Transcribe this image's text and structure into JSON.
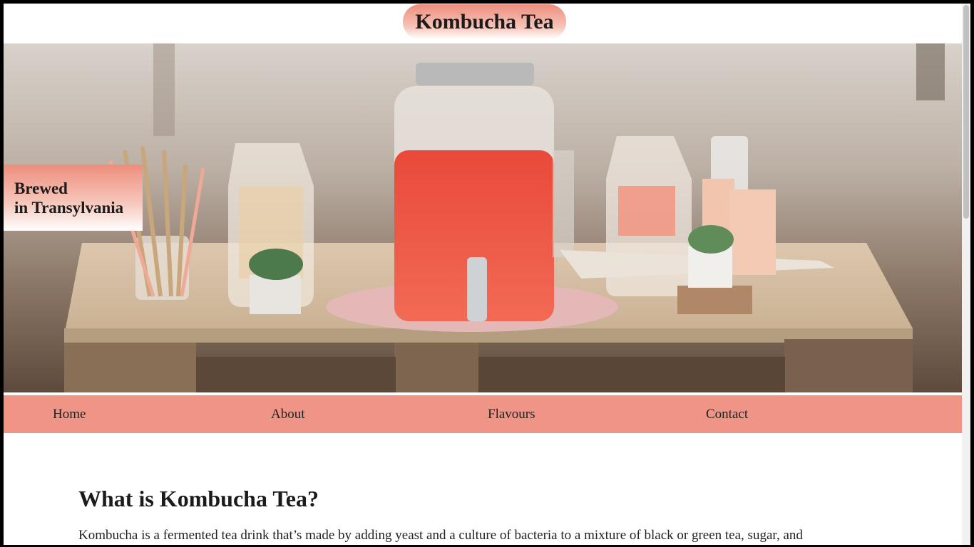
{
  "header": {
    "title": "Kombucha Tea"
  },
  "hero": {
    "alt": "Glass jar dispenser of red kombucha on a wooden pallet table with straws, pitchers, succulents and cups",
    "tagline_line1": "Brewed",
    "tagline_line2": "in Transylvania"
  },
  "nav": {
    "items": [
      "Home",
      "About",
      "Flavours",
      "Contact"
    ]
  },
  "main": {
    "heading": "What is Kombucha Tea?",
    "paragraph": "Kombucha is a fermented tea drink that’s made by adding yeast and a culture of bacteria to a mixture of black or green tea, sugar, and"
  },
  "colors": {
    "accent": "#f09585",
    "title_gradient_top": "#ee8d7d",
    "frame_border": "#000000"
  }
}
